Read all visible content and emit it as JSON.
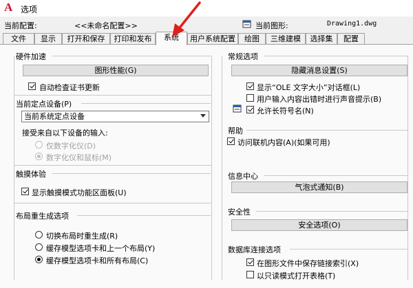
{
  "window": {
    "title": "选项"
  },
  "header": {
    "current_config_label": "当前配置:",
    "current_config_value": "<<未命名配置>>",
    "current_drawing_label": "当前图形:",
    "current_drawing_value": "Drawing1.dwg"
  },
  "tabs": [
    {
      "label": "文件"
    },
    {
      "label": "显示"
    },
    {
      "label": "打开和保存"
    },
    {
      "label": "打印和发布"
    },
    {
      "label": "系统"
    },
    {
      "label": "用户系统配置"
    },
    {
      "label": "绘图"
    },
    {
      "label": "三维建模"
    },
    {
      "label": "选择集"
    },
    {
      "label": "配置"
    }
  ],
  "active_tab": "系统",
  "left": {
    "hardware": {
      "title": "硬件加速",
      "button": "图形性能(G)",
      "auto_check_label": "自动检查证书更新",
      "auto_check_checked": true
    },
    "pointing": {
      "title": "当前定点设备(P)",
      "selected": "当前系统定点设备",
      "accept_label": "接受来自以下设备的输入:",
      "radio_digitizer_only": "仅数字化仪(D)",
      "radio_digitizer_mouse": "数字化仪和鼠标(M)",
      "selected_radio": "digitizer_mouse"
    },
    "touch": {
      "title": "触摸体验",
      "show_panel_label": "显示触摸模式功能区面板(U)",
      "show_panel_checked": true
    },
    "regen": {
      "title": "布局重生成选项",
      "opt1": "切换布局时重生成(R)",
      "opt2": "缓存模型选项卡和上一个布局(Y)",
      "opt3": "缓存模型选项卡和所有布局(C)",
      "selected": "opt3"
    }
  },
  "right": {
    "general": {
      "title": "常规选项",
      "button": "隐藏消息设置(S)",
      "ole_label": "显示“OLE 文字大小”对话框(L)",
      "ole_checked": true,
      "beep_label": "用户输入内容出错时进行声音提示(B)",
      "beep_checked": false,
      "longnames_label": "允许长符号名(N)",
      "longnames_checked": true
    },
    "help": {
      "title": "帮助",
      "online_label": "访问联机内容(A)(如果可用)",
      "online_checked": true
    },
    "info": {
      "title": "信息中心",
      "button": "气泡式通知(B)"
    },
    "security": {
      "title": "安全性",
      "button": "安全选项(O)"
    },
    "db": {
      "title": "数据库连接选项",
      "save_index_label": "在图形文件中保存链接索引(X)",
      "save_index_checked": true,
      "readonly_label": "以只读模式打开表格(T)",
      "readonly_checked": false
    }
  },
  "colors": {
    "accent_red": "#e0201b",
    "app_icon_red": "#c8102e"
  }
}
